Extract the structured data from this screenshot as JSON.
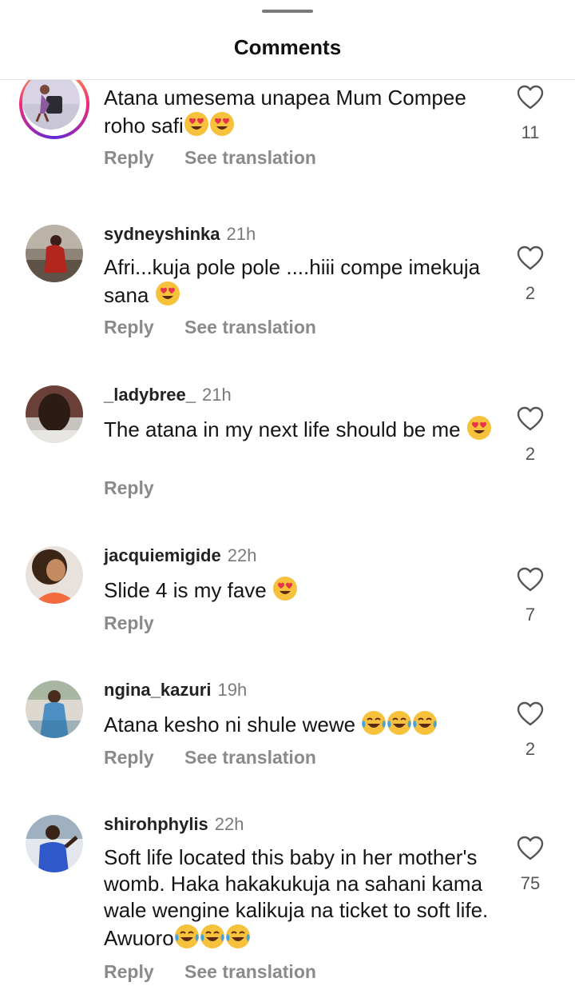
{
  "header": {
    "title": "Comments"
  },
  "comments": [
    {
      "text": "Atana umesema unapea Mum Compee roho safi",
      "emojis": [
        "heart-eyes",
        "heart-eyes"
      ],
      "reply_label": "Reply",
      "translate_label": "See translation",
      "likes": "11",
      "has_story_ring": true
    },
    {
      "username": "sydneyshinka",
      "time": "21h",
      "text": "Afri...kuja pole pole ....hiii compe imekuja sana ",
      "emojis": [
        "heart-eyes"
      ],
      "reply_label": "Reply",
      "translate_label": "See translation",
      "likes": "2"
    },
    {
      "username": "_ladybree_",
      "time": "21h",
      "text": "The atana in my next life should be me ",
      "emojis": [
        "heart-eyes"
      ],
      "reply_label": "Reply",
      "likes": "2"
    },
    {
      "username": "jacquiemigide",
      "time": "22h",
      "text": "Slide 4 is my fave ",
      "emojis": [
        "heart-eyes"
      ],
      "reply_label": "Reply",
      "likes": "7"
    },
    {
      "username": "ngina_kazuri",
      "time": "19h",
      "text": "Atana kesho ni shule wewe ",
      "emojis": [
        "tears-of-joy",
        "tears-of-joy",
        "tears-of-joy"
      ],
      "reply_label": "Reply",
      "translate_label": "See translation",
      "likes": "2"
    },
    {
      "username": "shirohphylis",
      "time": "22h",
      "text": "Soft life located this baby in her mother's womb. Haka hakakukuja na sahani kama wale wengine kalikuja na ticket to soft life. Awuoro",
      "emojis": [
        "tears-of-joy",
        "tears-of-joy",
        "tears-of-joy"
      ],
      "reply_label": "Reply",
      "translate_label": "See translation",
      "likes": "75"
    }
  ],
  "colors": {
    "text": "#151515",
    "muted": "#8a8a8a",
    "heart_stroke": "#555555"
  }
}
